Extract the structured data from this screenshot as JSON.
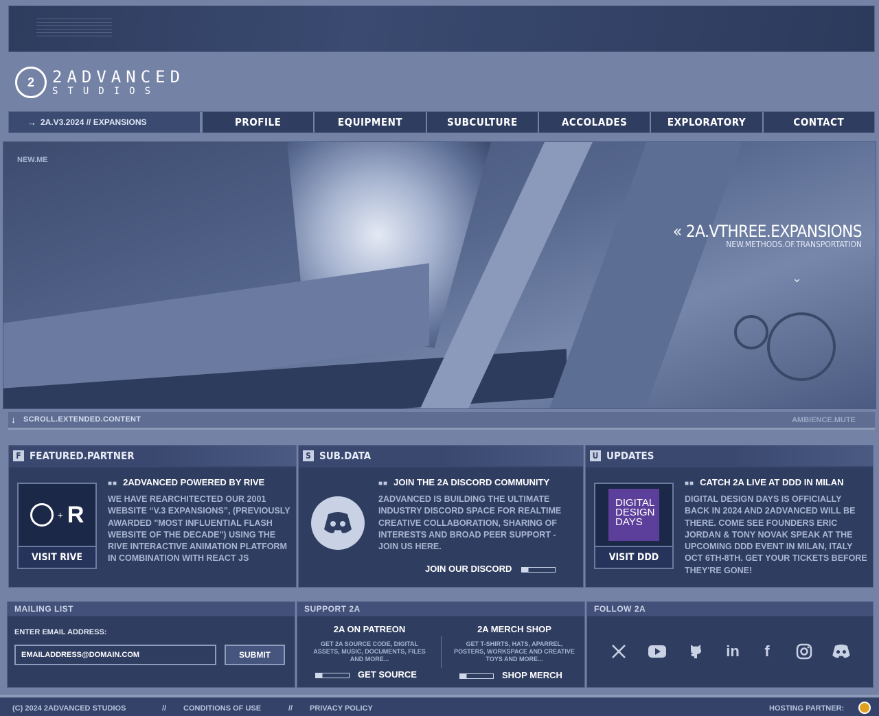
{
  "logo": {
    "line1": "2ADVANCED",
    "line2": "STUDIOS",
    "mark": "2"
  },
  "nav": {
    "home": "2A.V3.2024 // EXPANSIONS",
    "items": [
      "PROFILE",
      "EQUIPMENT",
      "SUBCULTURE",
      "ACCOLADES",
      "EXPLORATORY",
      "CONTACT"
    ]
  },
  "hero": {
    "corner_label": "NEW.ME",
    "title": "2A.VTHREE.EXPANSIONS",
    "subtitle": "NEW.METHODS.OF.TRANSPORTATION",
    "scroll_label": "SCROLL.EXTENDED.CONTENT",
    "ambience": "AMBIENCE.MUTE"
  },
  "panels": {
    "featured": {
      "badge": "F",
      "header": "FEATURED.PARTNER",
      "title": "2ADVANCED POWERED BY RIVE",
      "text": "WE HAVE REARCHITECTED OUR 2001 WEBSITE “V.3 EXPANSIONS”, (PREVIOUSLY AWARDED \"MOST INFLUENTIAL FLASH WEBSITE OF THE DECADE\") USING THE RIVE INTERACTIVE ANIMATION PLATFORM IN COMBINATION WITH REACT JS",
      "cta": "VISIT RIVE"
    },
    "subdata": {
      "badge": "S",
      "header": "SUB.DATA",
      "title": "JOIN THE 2A DISCORD COMMUNITY",
      "text": "2ADVANCED IS BUILDING THE ULTIMATE INDUSTRY DISCORD SPACE FOR REALTIME CREATIVE COLLABORATION, SHARING OF INTERESTS AND BROAD PEER SUPPORT - JOIN US HERE.",
      "cta": "JOIN OUR DISCORD"
    },
    "updates": {
      "badge": "U",
      "header": "UPDATES",
      "title": "CATCH 2A LIVE AT DDD IN MILAN",
      "text": "DIGITAL DESIGN DAYS IS OFFICIALLY BACK IN 2024 AND 2ADVANCED WILL BE THERE. COME SEE FOUNDERS ERIC JORDAN & TONY NOVAK SPEAK AT THE UPCOMING DDD EVENT IN MILAN, ITALY OCT 6TH-8TH. GET YOUR TICKETS BEFORE THEY'RE GONE!",
      "card_logo": [
        "DIGITAL",
        "DESIGN",
        "DAYS"
      ],
      "cta": "VISIT DDD"
    }
  },
  "mailing": {
    "header": "MAILING LIST",
    "label": "ENTER EMAIL ADDRESS:",
    "value": "EMAILADDRESS@DOMAIN.COM",
    "submit": "SUBMIT"
  },
  "support": {
    "header": "SUPPORT 2A",
    "patreon": {
      "title": "2A ON PATREON",
      "text": "GET 2A SOURCE CODE, DIGITAL ASSETS, MUSIC, DOCUMENTS, FILES AND MORE...",
      "link": "GET SOURCE"
    },
    "merch": {
      "title": "2A MERCH SHOP",
      "text": "GET T-SHIRTS, HATS, APARREL, POSTERS, WORKSPACE AND CREATIVE TOYS AND MORE...",
      "link": "SHOP MERCH"
    }
  },
  "follow": {
    "header": "FOLLOW 2A",
    "icons": [
      "x-icon",
      "youtube-icon",
      "github-icon",
      "linkedin-icon",
      "facebook-icon",
      "instagram-icon",
      "discord-icon"
    ]
  },
  "footer": {
    "copyright": "(C) 2024 2ADVANCED STUDIOS",
    "sep": "//",
    "conditions": "CONDITIONS OF USE",
    "privacy": "PRIVACY POLICY",
    "hosting": "HOSTING PARTNER:"
  },
  "colors": {
    "bg": "#7482a6",
    "panel": "#2f3d60",
    "accent": "#e8edf8"
  }
}
